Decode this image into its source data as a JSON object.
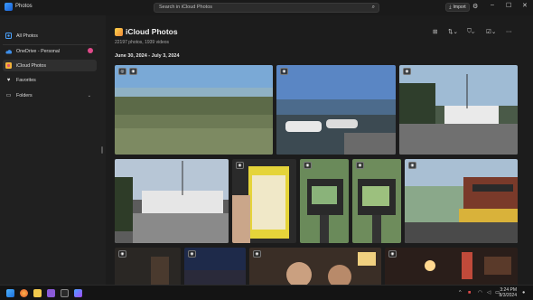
{
  "window": {
    "title": "Photos",
    "search_placeholder": "Search in iCloud Photos",
    "import_label": "Import",
    "icons": {
      "search": "search-icon",
      "import": "import-icon",
      "settings": "gear-icon",
      "minimize": "minimize-icon",
      "maximize": "maximize-icon",
      "close": "close-icon"
    }
  },
  "sidebar": {
    "items": [
      {
        "label": "All Photos",
        "icon": "photos-icon"
      },
      {
        "label": "OneDrive - Personal",
        "icon": "cloud-icon"
      },
      {
        "label": "iCloud Photos",
        "icon": "icloud-icon"
      },
      {
        "label": "Favorites",
        "icon": "heart-icon"
      },
      {
        "label": "Folders",
        "icon": "folder-icon"
      }
    ],
    "active_item": "iCloud Photos"
  },
  "main": {
    "title": "iCloud Photos",
    "subtitle": "22197 photos, 1939 videos",
    "date_range": "June 30, 2024 - July 3, 2024",
    "toolbar_icons": [
      "add-icon",
      "sort-icon",
      "filter-icon",
      "select-icon",
      "more-icon"
    ]
  },
  "photos": [
    {
      "scene": "beach-grass-water",
      "badges": [
        "hdr-icon",
        "live-photo-icon"
      ]
    },
    {
      "scene": "marina-boats",
      "badges": [
        "live-photo-icon"
      ]
    },
    {
      "scene": "dock-fishing-boat",
      "badges": [
        "live-photo-icon"
      ]
    },
    {
      "scene": "fishing-boat-dock",
      "badges": []
    },
    {
      "scene": "book-cover",
      "badges": [
        "live-photo-icon"
      ]
    },
    {
      "scene": "camera-screen",
      "badges": [
        "live-photo-icon"
      ]
    },
    {
      "scene": "camera-screen-2",
      "badges": [
        "live-photo-icon"
      ]
    },
    {
      "scene": "waterfront-street",
      "badges": [
        "live-photo-icon"
      ]
    },
    {
      "scene": "night-dark",
      "badges": [
        "live-photo-icon"
      ]
    },
    {
      "scene": "dusk-sky",
      "badges": [
        "live-photo-icon"
      ]
    },
    {
      "scene": "people-selfie",
      "badges": [
        "live-photo-icon"
      ]
    },
    {
      "scene": "bar-lights",
      "badges": [
        "live-photo-icon"
      ]
    }
  ],
  "taskbar": {
    "apps": [
      "start-icon",
      "firefox-icon",
      "explorer-icon",
      "visual-studio-icon",
      "terminal-icon",
      "photos-app-icon"
    ],
    "time": "3:24 PM",
    "date": "8/3/2024"
  },
  "colors": {
    "background": "#1c1c1c",
    "sidebar": "#202020",
    "active_nav": "#2f2f2f",
    "onedrive_badge": "#e04a8a"
  }
}
